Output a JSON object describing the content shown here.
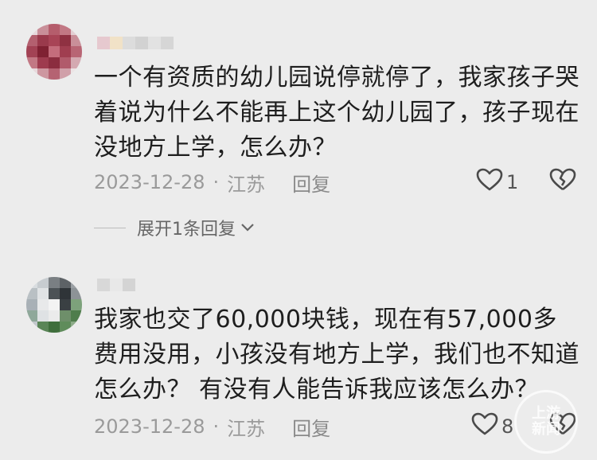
{
  "comments": [
    {
      "text": "一个有资质的幼儿园说停就停了，我家孩子哭着说为什么不能再上这个幼儿园了，孩子现在没地方上学，怎么办？",
      "date": "2023-12-28",
      "separator": "·",
      "location": "江苏",
      "reply_label": "回复",
      "like_count": "1",
      "expand_label": "展开1条回复"
    },
    {
      "text": "我家也交了60,000块钱，现在有57,000多费用没用，小孩没有地方上学，我们也不知道怎么办？ 有没有人能告诉我应该怎么办？",
      "date": "2023-12-28",
      "separator": "·",
      "location": "江苏",
      "reply_label": "回复",
      "like_count": "8"
    }
  ],
  "watermark": {
    "line1": "上游",
    "line2": "新闻"
  },
  "colors": {
    "background": "#ececec",
    "text": "#1e1e1e",
    "meta": "#9a9a9a"
  },
  "icons": {
    "like": "heart-icon",
    "dislike": "broken-heart-icon",
    "expand": "chevron-down-icon"
  }
}
